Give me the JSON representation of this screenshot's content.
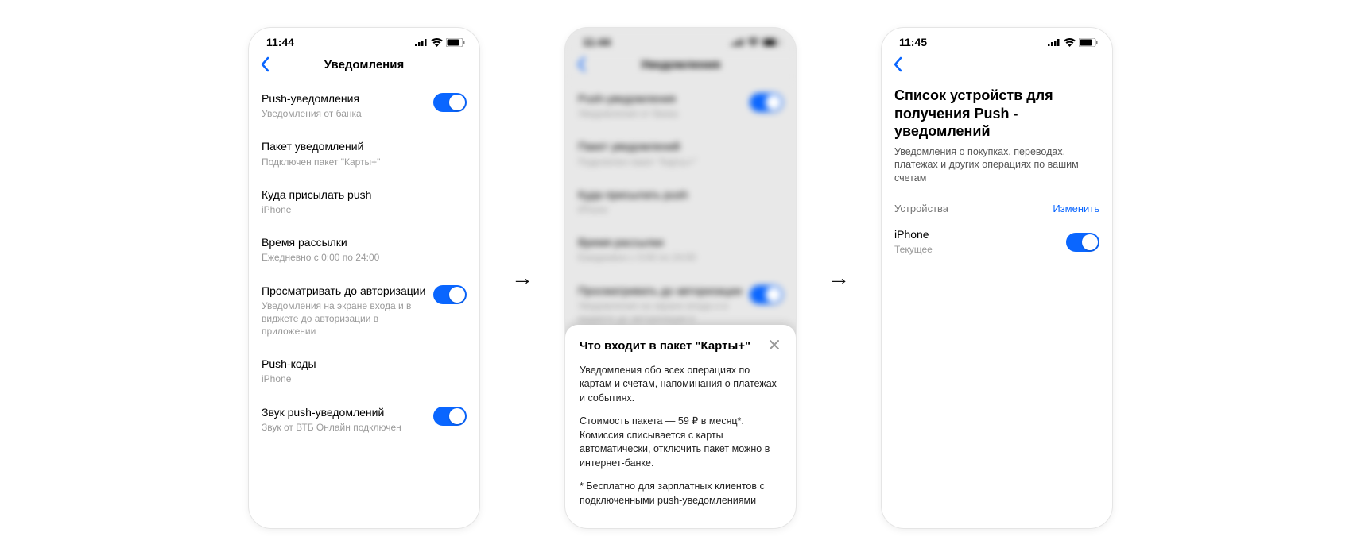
{
  "screen1": {
    "time": "11:44",
    "title": "Уведомления",
    "rows": [
      {
        "title": "Push-уведомления",
        "sub": "Уведомления от банка",
        "toggle": true
      },
      {
        "title": "Пакет уведомлений",
        "sub": "Подключен пакет \"Карты+\"",
        "toggle": false
      },
      {
        "title": "Куда присылать push",
        "sub": "iPhone",
        "toggle": false
      },
      {
        "title": "Время рассылки",
        "sub": "Ежедневно с 0:00 по 24:00",
        "toggle": false
      },
      {
        "title": "Просматривать до авторизации",
        "sub": "Уведомления на экране входа и в виджете до авторизации в приложении",
        "toggle": true
      },
      {
        "title": "Push-коды",
        "sub": "iPhone",
        "toggle": false
      },
      {
        "title": "Звук push-уведомлений",
        "sub": "Звук от ВТБ Онлайн подключен",
        "toggle": true
      }
    ]
  },
  "screen2": {
    "time": "11:44",
    "title": "Уведомления",
    "sheet": {
      "title": "Что входит в пакет \"Карты+\"",
      "p1": "Уведомления обо всех операциях по картам и счетам, напоминания о платежах и событиях.",
      "p2": "Стоимость пакета — 59 ₽ в месяц*. Комиссия списывается с карты автоматически, отключить пакет можно в интернет-банке.",
      "p3": "* Бесплатно для зарплатных клиентов с подключенными push-уведомлениями"
    }
  },
  "screen3": {
    "time": "11:45",
    "heading": "Список устройств для получения Push - уведомлений",
    "desc": "Уведомления о покупках, переводах, платежах и других операциях по вашим счетам",
    "section_label": "Устройства",
    "section_action": "Изменить",
    "device": {
      "name": "iPhone",
      "status": "Текущее"
    }
  }
}
